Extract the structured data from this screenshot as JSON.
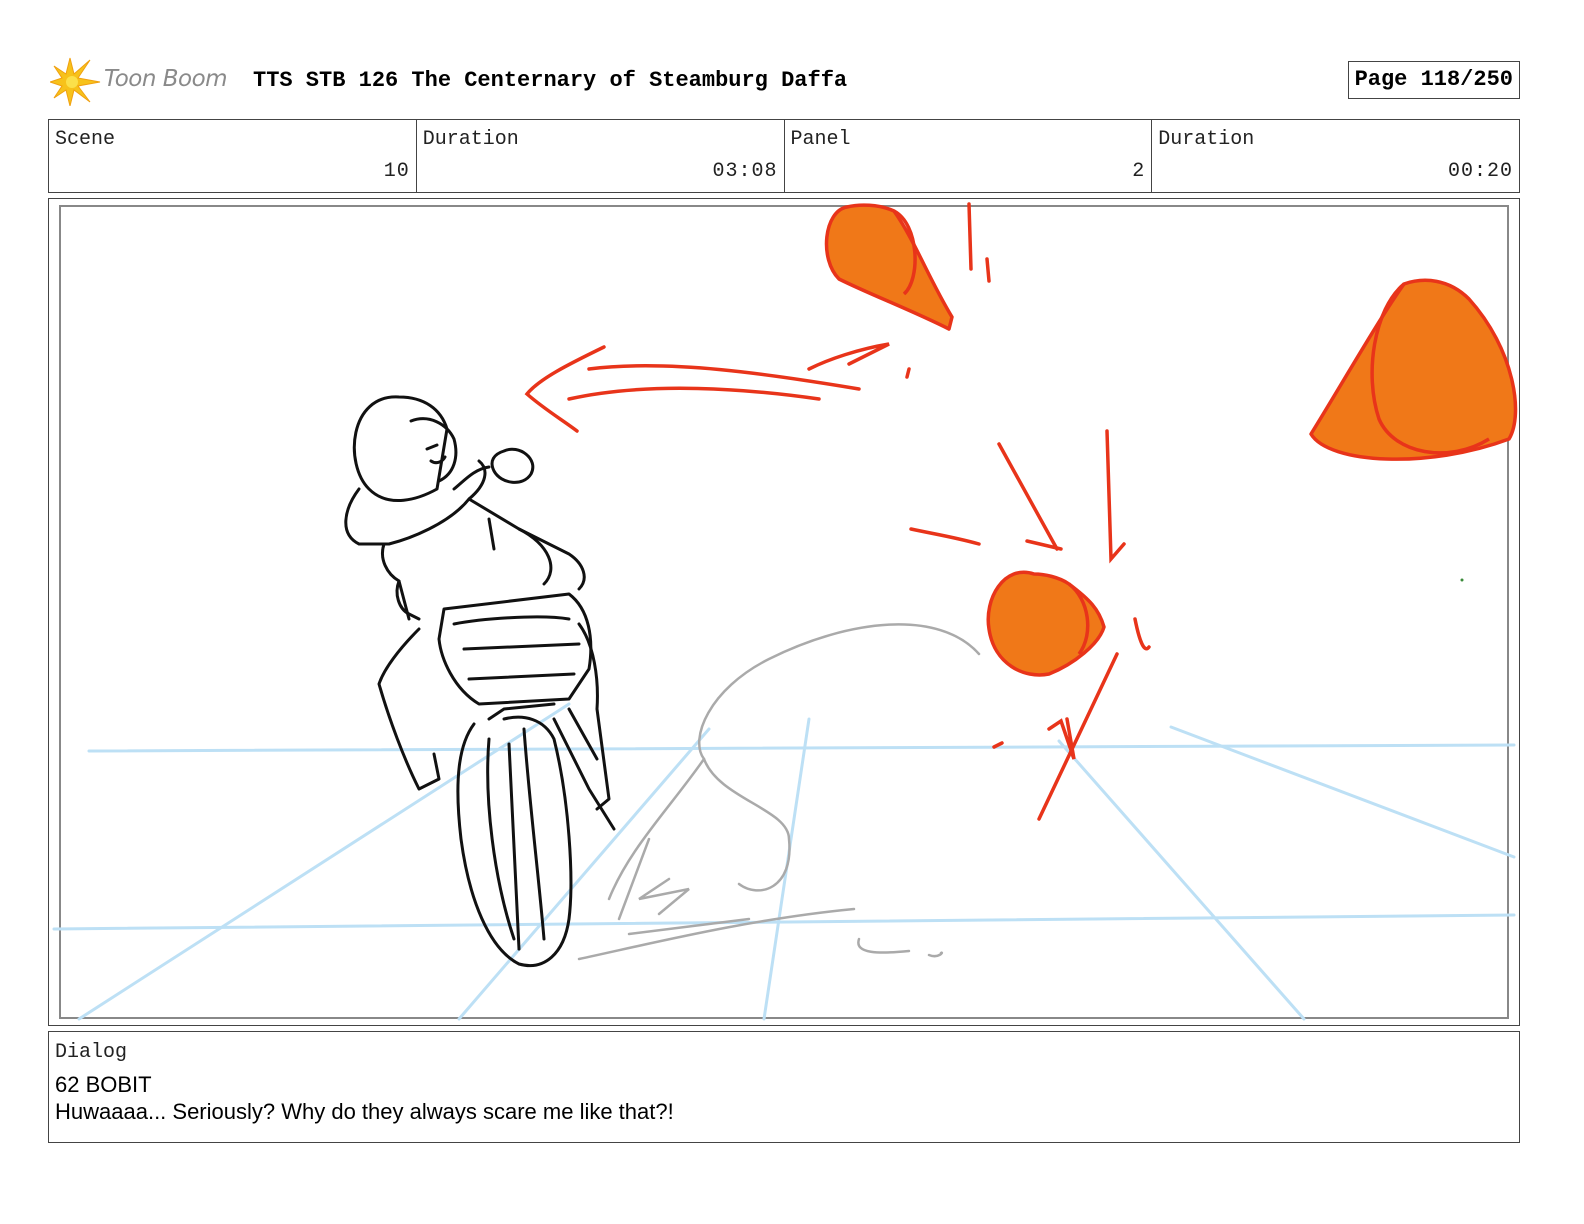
{
  "header": {
    "logo_text": "Toon Boom",
    "title": "TTS STB 126 The Centernary of Steamburg Daffa",
    "page_label": "Page 118/250"
  },
  "info": {
    "scene_label": "Scene",
    "scene_value": "10",
    "scene_duration_label": "Duration",
    "scene_duration_value": "03:08",
    "panel_label": "Panel",
    "panel_value": "2",
    "panel_duration_label": "Duration",
    "panel_duration_value": "00:20"
  },
  "colors": {
    "accent_orange": "#f07818",
    "stroke_red": "#e8341a",
    "guide_blue": "#bde0f5",
    "sketch_gray": "#aaaaaa",
    "logo_yellow": "#f7c21a"
  },
  "dialog": {
    "label": "Dialog",
    "speaker": "62 BOBIT",
    "line": "Huwaaaa... Seriously? Why do they always scare me like that?!"
  }
}
